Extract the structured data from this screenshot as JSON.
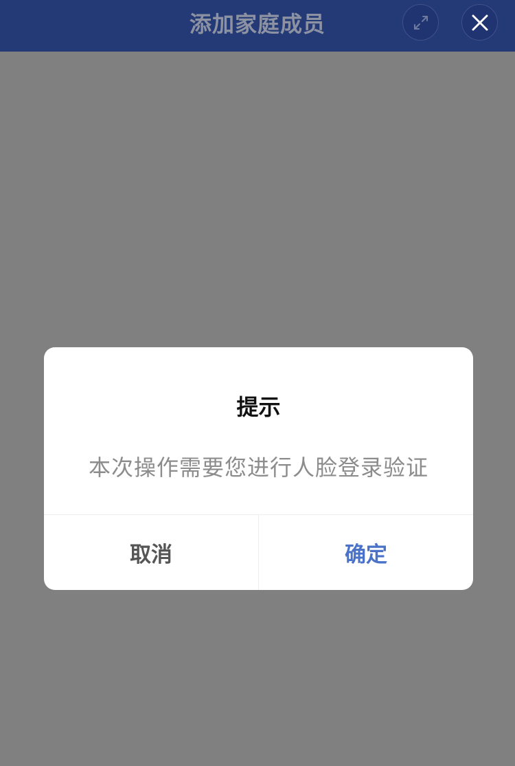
{
  "header": {
    "title": "添加家庭成员",
    "expand_icon": "expand-icon",
    "close_icon": "close-icon"
  },
  "dialog": {
    "title": "提示",
    "message": "本次操作需要您进行人脸登录验证",
    "cancel_label": "取消",
    "confirm_label": "确定"
  },
  "colors": {
    "header_bg": "#233a77",
    "overlay": "#808080",
    "confirm": "#4a72c8",
    "cancel": "#555555"
  }
}
